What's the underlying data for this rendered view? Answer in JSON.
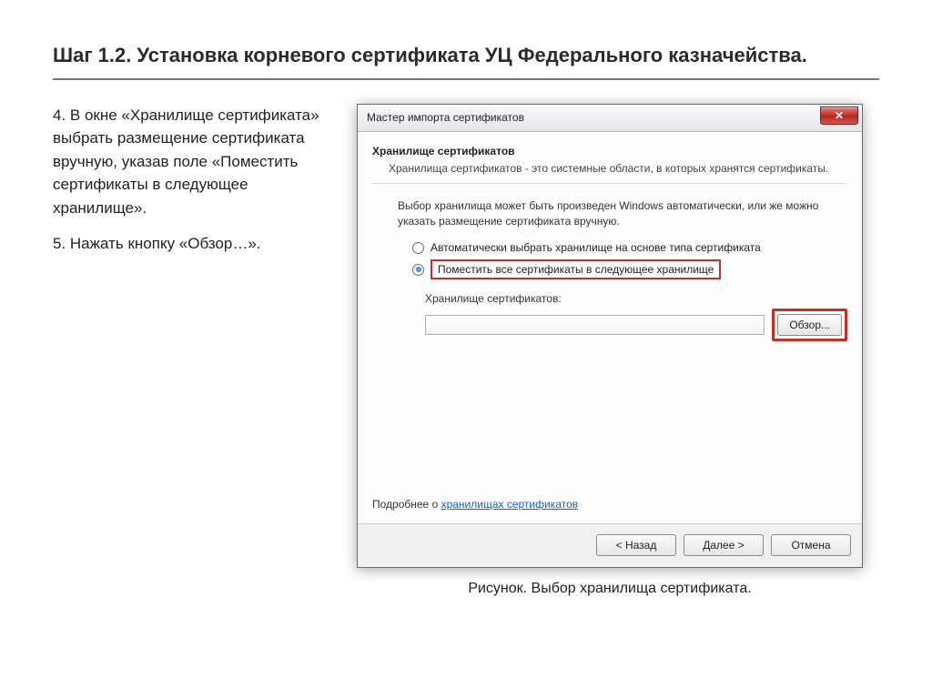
{
  "heading": "Шаг 1.2. Установка корневого сертификата УЦ Федерального казначейства.",
  "steps": {
    "s4": "4. В окне «Хранилище сертификата» выбрать размещение сертификата вручную, указав поле «Поместить сертификаты в следующее хранилище».",
    "s5": "5. Нажать кнопку «Обзор…»."
  },
  "window": {
    "title": "Мастер импорта сертификатов",
    "close_glyph": "✕",
    "section_title": "Хранилище сертификатов",
    "section_sub": "Хранилища сертификатов - это системные области, в которых хранятся сертификаты.",
    "paragraph": "Выбор хранилища может быть произведен Windows автоматически, или же можно указать размещение сертификата вручную.",
    "radio_auto": "Автоматически выбрать хранилище на основе типа сертификата",
    "radio_manual": "Поместить все сертификаты в следующее хранилище",
    "store_label": "Хранилище сертификатов:",
    "store_value": "",
    "browse_label": "Обзор...",
    "learn_prefix": "Подробнее о ",
    "learn_link": "хранилищах сертификатов",
    "back_label": "< Назад",
    "next_label": "Далее >",
    "cancel_label": "Отмена"
  },
  "caption": "Рисунок. Выбор хранилища сертификата."
}
